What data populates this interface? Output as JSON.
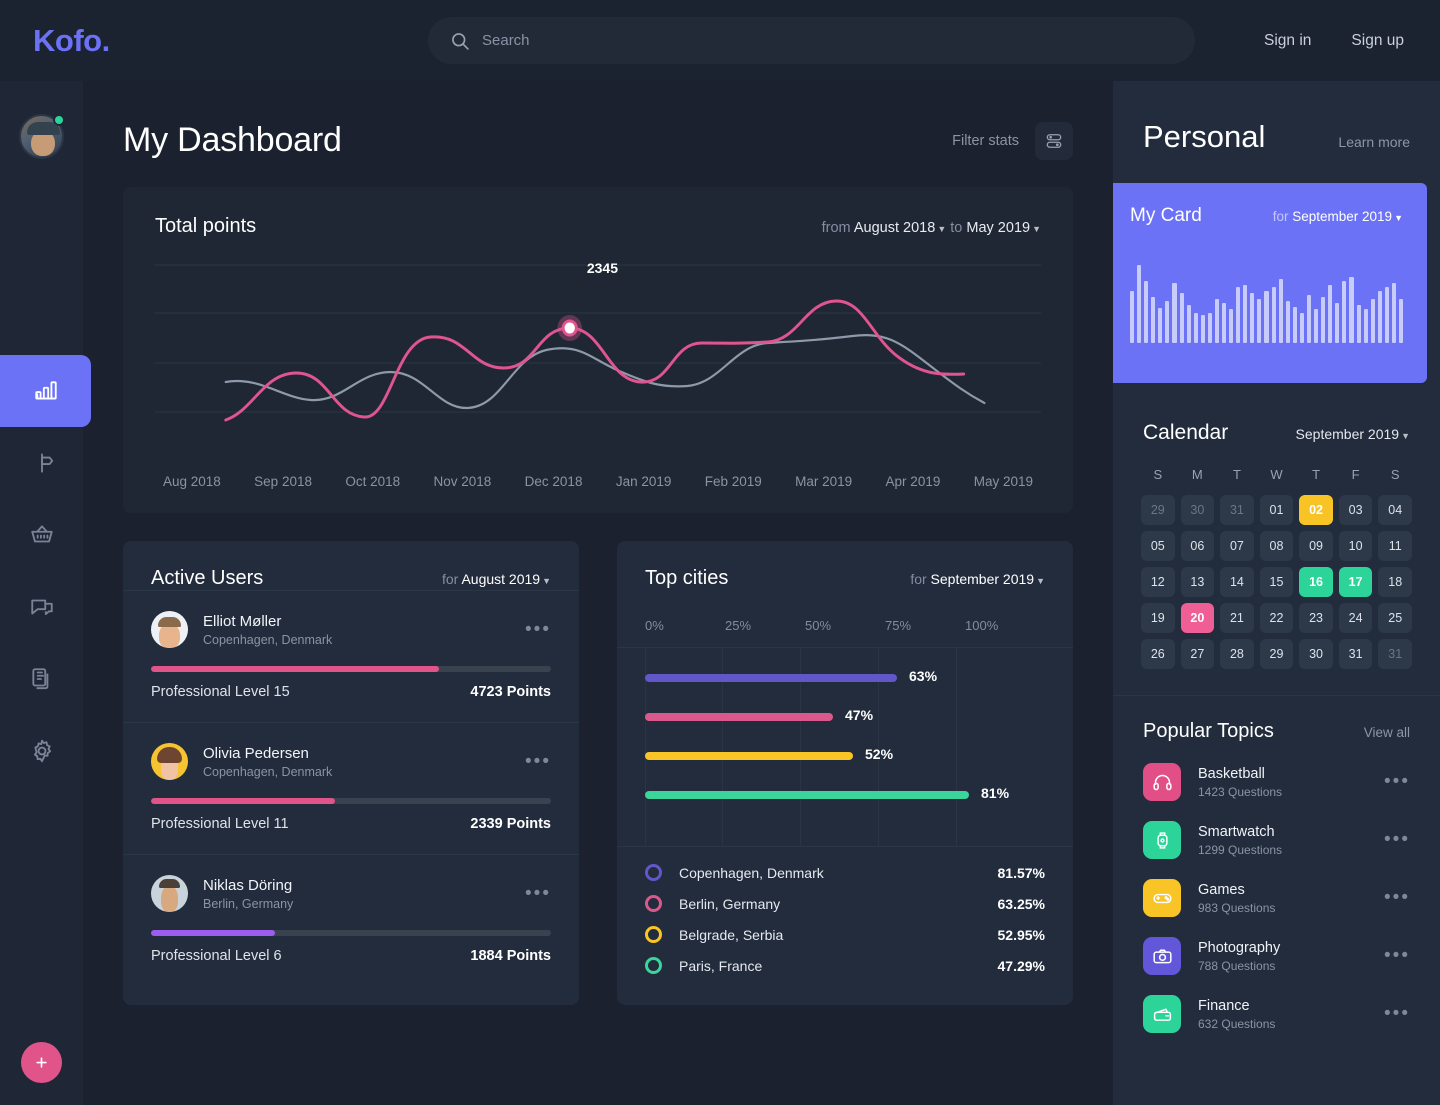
{
  "brand": {
    "logo": "Kofo."
  },
  "search": {
    "placeholder": "Search",
    "value": ""
  },
  "auth": {
    "signin": "Sign in",
    "signup": "Sign up"
  },
  "sidebar": {
    "items": [
      {
        "name": "analytics",
        "icon": "bar-chart-icon",
        "active": true
      },
      {
        "name": "signpost",
        "icon": "signpost-icon",
        "active": false
      },
      {
        "name": "basket",
        "icon": "basket-icon",
        "active": false
      },
      {
        "name": "messages",
        "icon": "chat-icon",
        "active": false
      },
      {
        "name": "documents",
        "icon": "document-icon",
        "active": false
      },
      {
        "name": "settings",
        "icon": "gear-icon",
        "active": false
      }
    ],
    "add_button": "+"
  },
  "header": {
    "title": "My Dashboard",
    "filter_label": "Filter stats",
    "filter_icon": "sliders-icon"
  },
  "total_points": {
    "title": "Total points",
    "from_label": "from",
    "from_value": "August 2018",
    "to_label": "to",
    "to_value": "May 2019",
    "tooltip_value": "2345"
  },
  "chart_data": {
    "type": "line",
    "title": "Total points",
    "xlabel": "",
    "ylabel": "",
    "categories": [
      "Aug 2018",
      "Sep 2018",
      "Oct 2018",
      "Nov 2018",
      "Dec 2018",
      "Jan 2019",
      "Feb 2019",
      "Mar 2019",
      "Apr 2019",
      "May 2019"
    ],
    "ylim": [
      0,
      4000
    ],
    "grid": true,
    "legend": "none",
    "annotations": [
      {
        "label": "2345",
        "x": "Jan 2019",
        "series": "Points"
      }
    ],
    "series": [
      {
        "name": "Points",
        "color": "#e05590",
        "values": [
          900,
          1900,
          1150,
          2400,
          2050,
          2345,
          1750,
          2500,
          2950,
          2150
        ]
      },
      {
        "name": "Average",
        "color": "#8e99aa",
        "values": [
          1900,
          1600,
          1850,
          1450,
          2300,
          1850,
          2350,
          2300,
          2500,
          1750
        ]
      }
    ]
  },
  "active_users": {
    "title": "Active Users",
    "for_label": "for",
    "for_value": "August 2019",
    "more_icon": "ellipsis-icon",
    "users": [
      {
        "name": "Elliot Møller",
        "location": "Copenhagen, Denmark",
        "level": "Professional Level 15",
        "points": "4723 Points",
        "progress": 72,
        "color": "#e0548a",
        "avatar_class": "a1"
      },
      {
        "name": "Olivia Pedersen",
        "location": "Copenhagen, Denmark",
        "level": "Professional Level 11",
        "points": "2339 Points",
        "progress": 46,
        "color": "#e0548a",
        "avatar_class": "a2"
      },
      {
        "name": "Niklas Döring",
        "location": "Berlin, Germany",
        "level": "Professional Level 6",
        "points": "1884 Points",
        "progress": 31,
        "color": "#9d5ef0",
        "avatar_class": "a3"
      }
    ]
  },
  "top_cities": {
    "title": "Top cities",
    "for_label": "for",
    "for_value": "September 2019",
    "axis": [
      "0%",
      "25%",
      "50%",
      "75%",
      "100%"
    ],
    "chart_data": {
      "type": "bar",
      "orientation": "horizontal",
      "title": "Top cities",
      "categories": [
        "Copenhagen, Denmark",
        "Berlin, Germany",
        "Belgrade, Serbia",
        "Paris, France"
      ],
      "bar_labels": [
        "63%",
        "47%",
        "52%",
        "81%"
      ],
      "values": [
        63,
        47,
        52,
        81
      ],
      "colors": [
        "#6257c9",
        "#d9598c",
        "#f8c426",
        "#3bd49a"
      ],
      "xlim": [
        0,
        100
      ],
      "xlabel": "",
      "ylabel": "",
      "grid": true
    },
    "legend": [
      {
        "name": "Copenhagen, Denmark",
        "value": "81.57%",
        "color": "#6257c9"
      },
      {
        "name": "Berlin, Germany",
        "value": "63.25%",
        "color": "#d9598c"
      },
      {
        "name": "Belgrade, Serbia",
        "value": "52.95%",
        "color": "#f8c426"
      },
      {
        "name": "Paris, France",
        "value": "47.29%",
        "color": "#3bd49a"
      }
    ]
  },
  "personal": {
    "title": "Personal",
    "learn_more": "Learn more"
  },
  "my_card": {
    "title": "My Card",
    "for_label": "for",
    "for_value": "September 2019",
    "chart_data": {
      "type": "bar",
      "title": "My Card",
      "categories": [
        "1",
        "2",
        "3",
        "4",
        "5",
        "6",
        "7",
        "8",
        "9",
        "10",
        "11",
        "12",
        "13",
        "14",
        "15",
        "16",
        "17",
        "18",
        "19",
        "20",
        "21",
        "22",
        "23",
        "24",
        "25",
        "26",
        "27",
        "28",
        "29",
        "30",
        "31",
        "32",
        "33",
        "34",
        "35",
        "36",
        "37",
        "38",
        "39",
        "40",
        "41",
        "42",
        "43",
        "44"
      ],
      "values": [
        52,
        78,
        62,
        46,
        35,
        42,
        60,
        50,
        38,
        30,
        28,
        30,
        44,
        40,
        34,
        56,
        58,
        50,
        44,
        52,
        56,
        64,
        42,
        36,
        30,
        48,
        34,
        46,
        58,
        40,
        62,
        66,
        38,
        34,
        44,
        52,
        56,
        60,
        44
      ],
      "ylim": [
        0,
        90
      ],
      "color": "#c8ccfb"
    }
  },
  "calendar": {
    "title": "Calendar",
    "month": "September 2019",
    "dow": [
      "S",
      "M",
      "T",
      "W",
      "T",
      "F",
      "S"
    ],
    "days": [
      {
        "n": "29",
        "state": "muted"
      },
      {
        "n": "30",
        "state": "muted"
      },
      {
        "n": "31",
        "state": "muted"
      },
      {
        "n": "01",
        "state": ""
      },
      {
        "n": "02",
        "state": "yellow"
      },
      {
        "n": "03",
        "state": ""
      },
      {
        "n": "04",
        "state": ""
      },
      {
        "n": "05",
        "state": ""
      },
      {
        "n": "06",
        "state": ""
      },
      {
        "n": "07",
        "state": ""
      },
      {
        "n": "08",
        "state": ""
      },
      {
        "n": "09",
        "state": ""
      },
      {
        "n": "10",
        "state": ""
      },
      {
        "n": "11",
        "state": ""
      },
      {
        "n": "12",
        "state": ""
      },
      {
        "n": "13",
        "state": ""
      },
      {
        "n": "14",
        "state": ""
      },
      {
        "n": "15",
        "state": ""
      },
      {
        "n": "16",
        "state": "green"
      },
      {
        "n": "17",
        "state": "green"
      },
      {
        "n": "18",
        "state": ""
      },
      {
        "n": "19",
        "state": ""
      },
      {
        "n": "20",
        "state": "pink"
      },
      {
        "n": "21",
        "state": ""
      },
      {
        "n": "22",
        "state": ""
      },
      {
        "n": "23",
        "state": ""
      },
      {
        "n": "24",
        "state": ""
      },
      {
        "n": "25",
        "state": ""
      },
      {
        "n": "26",
        "state": ""
      },
      {
        "n": "27",
        "state": ""
      },
      {
        "n": "28",
        "state": ""
      },
      {
        "n": "29",
        "state": ""
      },
      {
        "n": "30",
        "state": ""
      },
      {
        "n": "31",
        "state": ""
      },
      {
        "n": "31",
        "state": "muted"
      }
    ]
  },
  "popular_topics": {
    "title": "Popular Topics",
    "view_all": "View all",
    "more_icon": "ellipsis-icon",
    "items": [
      {
        "name": "Basketball",
        "count": "1423 Questions",
        "color": "#e24f86",
        "icon": "headphones-icon"
      },
      {
        "name": "Smartwatch",
        "count": "1299 Questions",
        "color": "#2dd49a",
        "icon": "smartwatch-icon"
      },
      {
        "name": "Games",
        "count": "983 Questions",
        "color": "#f8c426",
        "icon": "gamepad-icon"
      },
      {
        "name": "Photography",
        "count": "788 Questions",
        "color": "#6257d8",
        "icon": "camera-icon"
      },
      {
        "name": "Finance",
        "count": "632 Questions",
        "color": "#2dd49a",
        "icon": "wallet-icon"
      }
    ]
  },
  "colors": {
    "accent": "#6b72f6",
    "pink": "#e0548a",
    "green": "#2dd49a",
    "yellow": "#f8c426",
    "purple": "#9d5ef0",
    "bg": "#1b212e",
    "card": "#222c3c"
  }
}
